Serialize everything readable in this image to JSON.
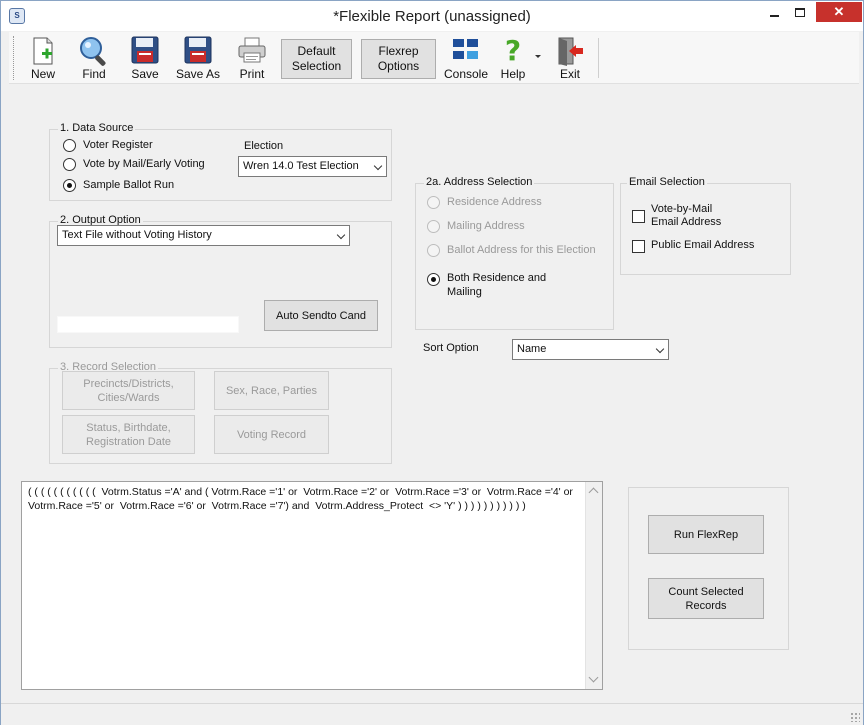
{
  "window": {
    "title": "*Flexible Report (unassigned)",
    "icon": "app-logo-icon"
  },
  "toolbar": {
    "new": "New",
    "find": "Find",
    "save": "Save",
    "save_as": "Save As",
    "print": "Print",
    "default_selection": "Default Selection",
    "flexrep_options": "Flexrep Options",
    "console": "Console",
    "help": "Help",
    "exit": "Exit"
  },
  "data_source": {
    "legend": "1.  Data Source",
    "options": [
      "Voter Register",
      "Vote by Mail/Early Voting",
      "Sample Ballot Run"
    ],
    "selected": "Sample Ballot Run",
    "election_label": "Election",
    "election_value": "Wren 14.0 Test Election"
  },
  "output_option": {
    "legend": "2.  Output Option",
    "value": "Text File without Voting History",
    "auto_send_button": "Auto Sendto Cand"
  },
  "record_selection": {
    "legend": "3.  Record Selection",
    "precincts": "Precincts/Districts, Cities/Wards",
    "sex_race": "Sex, Race, Parties",
    "status": "Status, Birthdate, Registration Date",
    "voting_record": "Voting Record"
  },
  "address_selection": {
    "legend": "2a.  Address Selection",
    "residence": "Residence Address",
    "mailing": "Mailing Address",
    "ballot": "Ballot Address for this Election",
    "both": "Both Residence and Mailing"
  },
  "email_selection": {
    "legend": "Email Selection",
    "vbm": "Vote-by-Mail Email Address",
    "public": "Public Email Address"
  },
  "sort": {
    "label": "Sort Option",
    "value": "Name"
  },
  "query": {
    "text": "( ( ( ( ( ( ( ( ( ( (  Votrm.Status ='A' and ( Votrm.Race ='1' or  Votrm.Race ='2' or  Votrm.Race ='3' or  Votrm.Race ='4' or  Votrm.Race ='5' or  Votrm.Race ='6' or  Votrm.Race ='7') and  Votrm.Address_Protect  <> 'Y' ) ) ) ) ) ) ) ) ) ) )"
  },
  "actions": {
    "run": "Run FlexRep",
    "count": "Count Selected Records"
  }
}
